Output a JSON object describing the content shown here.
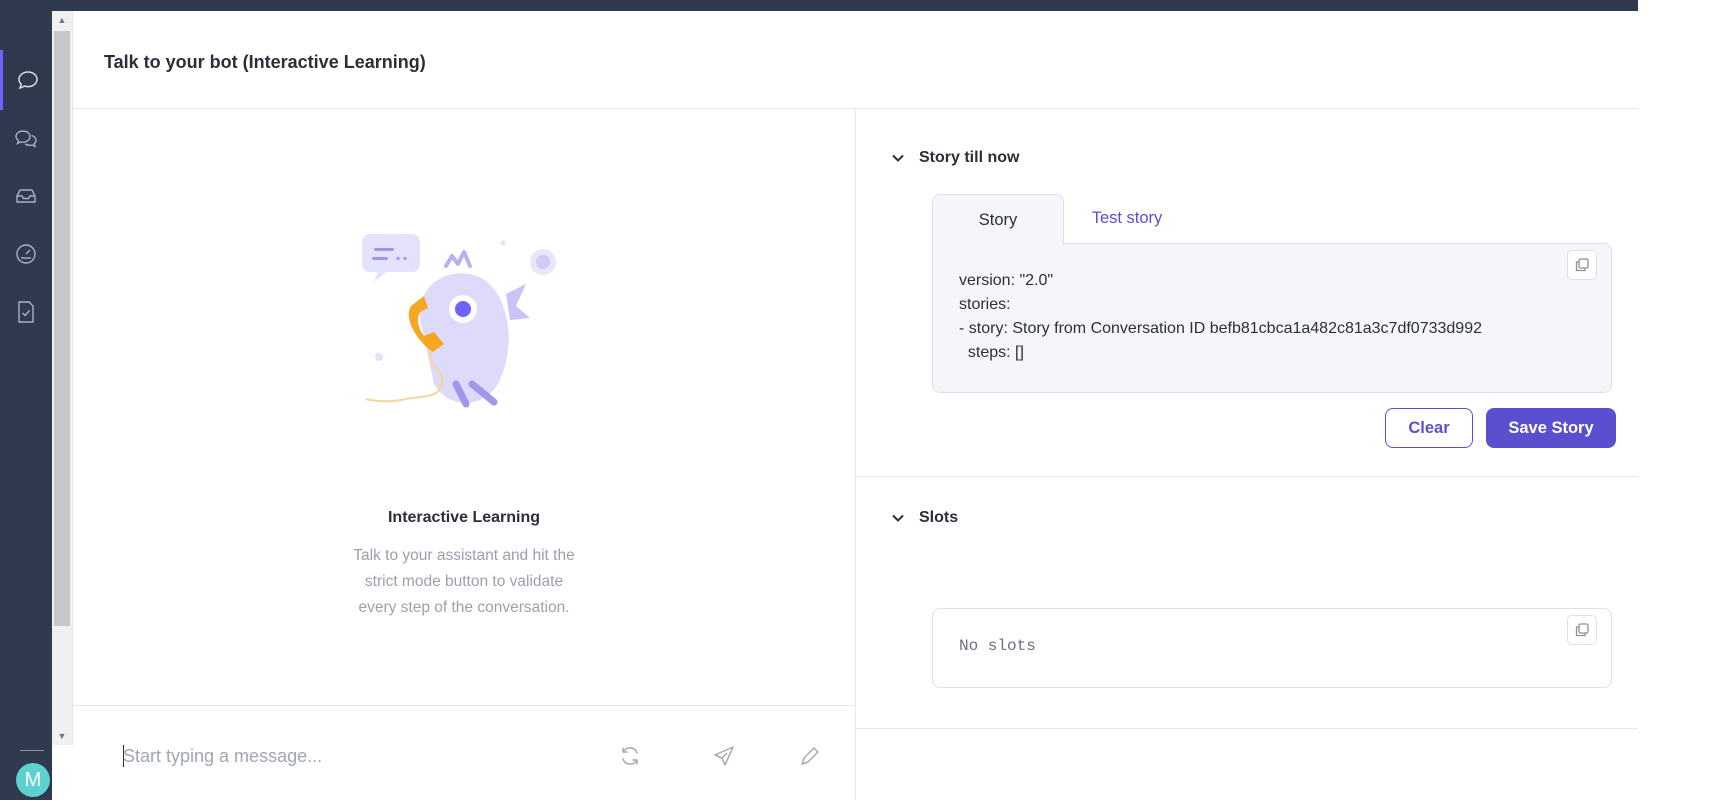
{
  "header": {
    "title": "Talk to your bot (Interactive Learning)"
  },
  "sidebar": {
    "items": [
      {
        "icon": "chat-bubble-icon",
        "active": true
      },
      {
        "icon": "conversations-icon",
        "active": false
      },
      {
        "icon": "inbox-icon",
        "active": false
      },
      {
        "icon": "dashboard-gauge-icon",
        "active": false
      },
      {
        "icon": "document-check-icon",
        "active": false
      }
    ],
    "avatar_initial": "M"
  },
  "left": {
    "title": "Interactive Learning",
    "description_lines": [
      "Talk to your assistant and hit the",
      "strict mode button to validate",
      "every step of the conversation."
    ]
  },
  "composer": {
    "placeholder": "Start typing a message...",
    "icons": [
      "refresh-icon",
      "send-icon",
      "pen-icon"
    ]
  },
  "story_section": {
    "heading": "Story till now",
    "tabs": [
      {
        "label": "Story",
        "active": true
      },
      {
        "label": "Test story",
        "active": false
      }
    ],
    "code_lines": [
      "version: \"2.0\"",
      "stories:",
      "- story: Story from Conversation ID befb81cbca1a482c81a3c7df0733d992",
      "  steps: []"
    ],
    "clear_label": "Clear",
    "save_label": "Save Story"
  },
  "slots_section": {
    "heading": "Slots",
    "content": "No slots"
  },
  "colors": {
    "sidebar": "#2f3a4f",
    "accent": "#5a4fcf",
    "avatar": "#5cd1cf"
  }
}
